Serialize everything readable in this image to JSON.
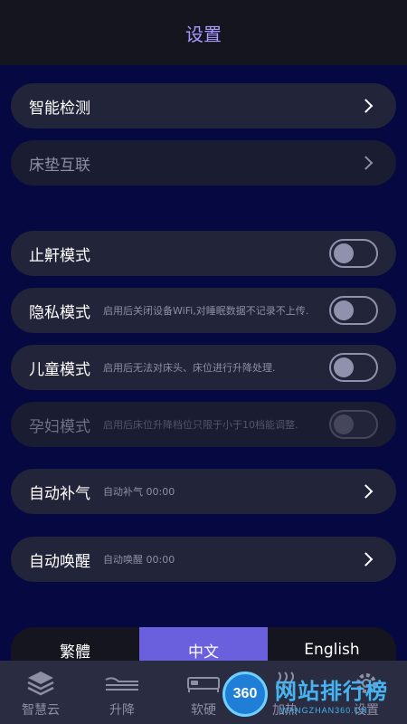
{
  "header": {
    "title": "设置"
  },
  "rows": {
    "smart_detect": {
      "label": "智能检测"
    },
    "mattress_link": {
      "label": "床垫互联"
    },
    "snore_stop": {
      "label": "止鼾模式",
      "on": false
    },
    "privacy": {
      "label": "隐私模式",
      "desc": "启用后关闭设备WiFi,对睡眠数据不记录不上传.",
      "on": false
    },
    "child": {
      "label": "儿童模式",
      "desc": "启用后无法对床头、床位进行升降处理.",
      "on": false
    },
    "pregnant": {
      "label": "孕妇模式",
      "desc": "启用后床位升降档位只限于小于10档能调整.",
      "on": false
    },
    "auto_inflate": {
      "label": "自动补气",
      "desc": "自动补气 00:00"
    },
    "auto_wake": {
      "label": "自动唤醒",
      "desc": "自动唤醒 00:00"
    }
  },
  "language": {
    "options": [
      "繁體",
      "中文",
      "English"
    ],
    "selected": "中文"
  },
  "tabbar": {
    "items": [
      {
        "label": "智慧云",
        "icon": "layers-icon"
      },
      {
        "label": "升降",
        "icon": "bed-lift-icon"
      },
      {
        "label": "软硬",
        "icon": "bed-icon"
      },
      {
        "label": "加热",
        "icon": "heat-icon"
      },
      {
        "label": "设置",
        "icon": "gear-icon"
      }
    ]
  },
  "watermark": {
    "number": "360",
    "text": "网站排行榜",
    "sub": "WANGZHAN360.CN"
  },
  "colors": {
    "accent": "#6a5fdc",
    "title": "#a69cff",
    "background": "#060842",
    "row": "#22243a"
  }
}
